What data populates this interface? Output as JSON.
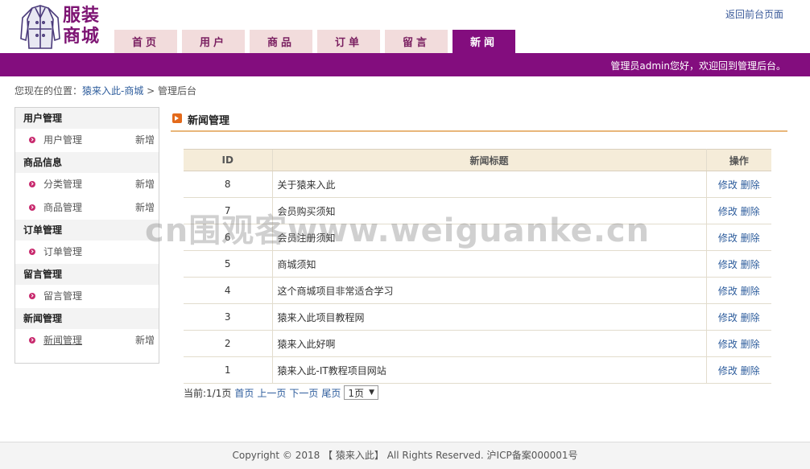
{
  "header": {
    "logo_text": [
      "服装",
      "商城"
    ],
    "back_link": "返回前台页面",
    "tabs": [
      "首页",
      "用户",
      "商品",
      "订单",
      "留言",
      "新闻"
    ],
    "active_tab": 5,
    "welcome": "管理员admin您好，欢迎回到管理后台。"
  },
  "breadcrumb": {
    "prefix": "您现在的位置：",
    "site": "猿来入此-商城",
    "sep": " > ",
    "current": "管理后台"
  },
  "sidebar": {
    "groups": [
      {
        "title": "用户管理",
        "items": [
          {
            "label": "用户管理",
            "add": "新增"
          }
        ]
      },
      {
        "title": "商品信息",
        "items": [
          {
            "label": "分类管理",
            "add": "新增"
          },
          {
            "label": "商品管理",
            "add": "新增"
          }
        ]
      },
      {
        "title": "订单管理",
        "items": [
          {
            "label": "订单管理",
            "add": ""
          }
        ]
      },
      {
        "title": "留言管理",
        "items": [
          {
            "label": "留言管理",
            "add": ""
          }
        ]
      },
      {
        "title": "新闻管理",
        "items": [
          {
            "label": "新闻管理",
            "add": "新增"
          }
        ]
      }
    ]
  },
  "main": {
    "title": "新闻管理",
    "table": {
      "headers": [
        "ID",
        "新闻标题",
        "操作"
      ],
      "rows": [
        {
          "id": "8",
          "title": "关于猿来入此"
        },
        {
          "id": "7",
          "title": "会员购买须知"
        },
        {
          "id": "6",
          "title": "会员注册须知"
        },
        {
          "id": "5",
          "title": "商城须知"
        },
        {
          "id": "4",
          "title": "这个商城项目非常适合学习"
        },
        {
          "id": "3",
          "title": "猿来入此项目教程网"
        },
        {
          "id": "2",
          "title": "猿来入此好啊"
        },
        {
          "id": "1",
          "title": "猿来入此-IT教程项目网站"
        }
      ],
      "edit_label": "修改",
      "delete_label": "删除"
    },
    "pager": {
      "current": "当前:1/1页",
      "first": "首页",
      "prev": "上一页",
      "next": "下一页",
      "last": "尾页",
      "select_value": "1页"
    }
  },
  "footer": "Copyright © 2018 【 猿来入此】 All Rights Reserved. 沪ICP备案000001号",
  "watermark": "cn围观客www.weiguanke.cn"
}
